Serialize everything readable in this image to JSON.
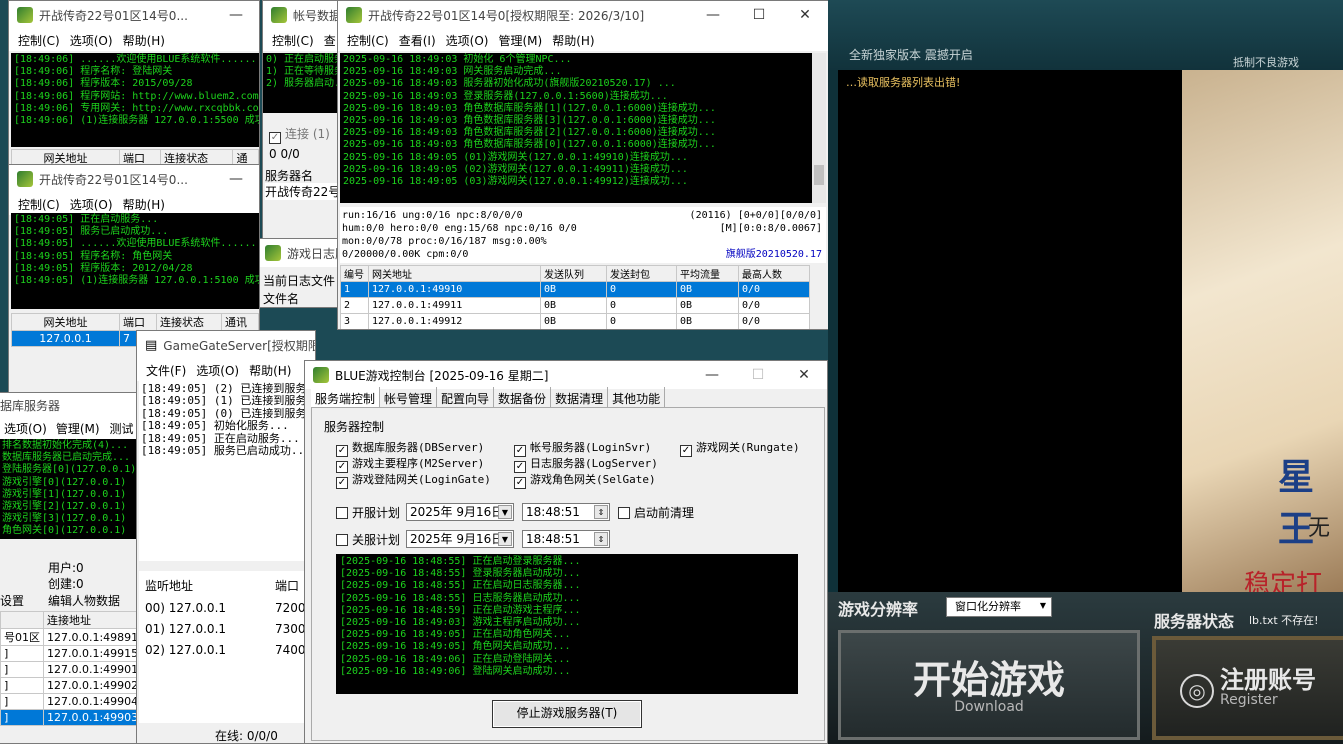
{
  "gate1": {
    "title": "开战传奇22号01区14号0...",
    "menu": [
      "控制(C)",
      "选项(O)",
      "帮助(H)"
    ],
    "log": [
      "[18:49:06] ......欢迎使用BLUE系统软件......",
      "[18:49:06] 程序名称: 登陆网关",
      "[18:49:06] 程序版本: 2015/09/28",
      "[18:49:06] 程序网站: http://www.bluem2.com",
      "[18:49:06] 专用网关: http://www.rxcqbbk.com",
      "[18:49:06] (1)连接服务器 127.0.0.1:5500 成功..."
    ],
    "cols": [
      "网关地址",
      "端口",
      "连接状态",
      "通"
    ]
  },
  "gate2": {
    "title": "开战传奇22号01区14号0...",
    "menu": [
      "控制(C)",
      "选项(O)",
      "帮助(H)"
    ],
    "log": [
      "[18:49:05] 正在启动服务...",
      "[18:49:05] 服务已启动成功...",
      "[18:49:05] ......欢迎使用BLUE系统软件......",
      "[18:49:05] 程序名称: 角色网关",
      "[18:49:05] 程序版本: 2012/04/28",
      "[18:49:05] (1)连接服务器 127.0.0.1:5100 成功"
    ],
    "cols": [
      "网关地址",
      "端口",
      "连接状态",
      "通讯"
    ],
    "rows": [
      [
        "127.0.0.1",
        "7"
      ]
    ]
  },
  "account": {
    "title": "帐号数据",
    "menu": [
      "控制(C)",
      "查"
    ],
    "log": [
      "0) 正在启动服务...",
      "1) 正在等待服务器...",
      "2) 服务器启动..."
    ],
    "check_label": "连接",
    "check_count": "(1)",
    "counts": "0   0/0",
    "header": "服务器名",
    "row": "开战传奇22号"
  },
  "logsrv": {
    "title": "游戏日志服",
    "current_file": "当前日志文件",
    "file_name": "文件名"
  },
  "m2": {
    "title": "开战传奇22号01区14号0[授权期限至: 2026/3/10]",
    "menu": [
      "控制(C)",
      "查看(I)",
      "选项(O)",
      "管理(M)",
      "帮助(H)"
    ],
    "log": [
      "2025-09-16 18:49:03 初始化 6个管理NPC...",
      "2025-09-16 18:49:03 网关服务启动完成...",
      "2025-09-16 18:49:03 服务器初始化成功(旗舰版20210520.17) ...",
      "2025-09-16 18:49:03 登录服务器(127.0.0.1:5600)连接成功...",
      "2025-09-16 18:49:03 角色数据库服务器[1](127.0.0.1:6000)连接成功...",
      "2025-09-16 18:49:03 角色数据库服务器[3](127.0.0.1:6000)连接成功...",
      "2025-09-16 18:49:03 角色数据库服务器[2](127.0.0.1:6000)连接成功...",
      "2025-09-16 18:49:03 角色数据库服务器[0](127.0.0.1:6000)连接成功...",
      "2025-09-16 18:49:05 (01)游戏网关(127.0.0.1:49910)连接成功...",
      "2025-09-16 18:49:05 (02)游戏网关(127.0.0.1:49911)连接成功...",
      "2025-09-16 18:49:05 (03)游戏网关(127.0.0.1:49912)连接成功..."
    ],
    "stat1": "run:16/16 ung:0/16 npc:8/0/0/0",
    "stat1r": "(20116) [0+0/0][0/0/0]",
    "stat2": "hum:0/0 hero:0/0 eng:15/68 npc:0/16 0/0",
    "stat2r": "[M][0:0:8/0.0067]",
    "stat3": "mon:0/0/78 proc:0/16/187 msg:0.00%",
    "stat4": "0/20000/0.00K cpm:0/0",
    "version": "旗舰版20210520.17",
    "cols": [
      "编号",
      "网关地址",
      "发送队列",
      "发送封包",
      "平均流量",
      "最高人数"
    ],
    "rows": [
      [
        "1",
        "127.0.0.1:49910",
        "0B",
        "0",
        "0B",
        "0/0"
      ],
      [
        "2",
        "127.0.0.1:49911",
        "0B",
        "0",
        "0B",
        "0/0"
      ],
      [
        "3",
        "127.0.0.1:49912",
        "0B",
        "0",
        "0B",
        "0/0"
      ]
    ]
  },
  "db": {
    "title": "据库服务器",
    "menu": [
      "选项(O)",
      "管理(M)",
      "测试"
    ],
    "log": [
      "排名数据初始化完成(4)...",
      "数据库服务器已启动完成...",
      "登陆服务器[0](127.0.0.1)",
      "游戏引擎[0](127.0.0.1)",
      "游戏引擎[1](127.0.0.1)",
      "游戏引擎[2](127.0.0.1)",
      "游戏引擎[3](127.0.0.1)",
      "角色网关[0](127.0.0.1)"
    ],
    "users": "用户:0",
    "created": "创建:0",
    "setting": "设置",
    "edit": "编辑人物数据",
    "cols": [
      "",
      "连接地址"
    ],
    "rows": [
      [
        "号01区",
        "127.0.0.1:49891"
      ],
      [
        "]",
        "127.0.0.1:49915"
      ],
      [
        "]",
        "127.0.0.1:49901"
      ],
      [
        "]",
        "127.0.0.1:49902"
      ],
      [
        "]",
        "127.0.0.1:49904"
      ],
      [
        "]",
        "127.0.0.1:49903"
      ]
    ]
  },
  "gamegate": {
    "title": "GameGateServer[授权期限至:",
    "menu": [
      "文件(F)",
      "选项(O)",
      "帮助(H)"
    ],
    "log": [
      "[18:49:05] (2) 已连接到服务器",
      "[18:49:05] (1) 已连接到服务器",
      "[18:49:05] (0) 已连接到服务器",
      "[18:49:05] 初始化服务...",
      "[18:49:05] 正在启动服务...",
      "[18:49:05] 服务已启动成功..."
    ],
    "cols": [
      "监听地址",
      "端口"
    ],
    "rows": [
      [
        "00) 127.0.0.1",
        "7200"
      ],
      [
        "01) 127.0.0.1",
        "7300"
      ],
      [
        "02) 127.0.0.1",
        "7400"
      ]
    ],
    "online": "在线: 0/0/0"
  },
  "console": {
    "title": "BLUE游戏控制台 [2025-09-16 星期二]",
    "tabs": [
      "服务端控制",
      "帐号管理",
      "配置向导",
      "数据备份",
      "数据清理",
      "其他功能"
    ],
    "group": "服务器控制",
    "checks": [
      {
        "label": "数据库服务器(DBServer)",
        "checked": true
      },
      {
        "label": "帐号服务器(LoginSvr)",
        "checked": true
      },
      {
        "label": "游戏网关(Rungate)",
        "checked": true
      },
      {
        "label": "游戏主要程序(M2Server)",
        "checked": true
      },
      {
        "label": "日志服务器(LogServer)",
        "checked": true
      },
      {
        "label": "游戏登陆网关(LoginGate)",
        "checked": true
      },
      {
        "label": "游戏角色网关(SelGate)",
        "checked": true
      }
    ],
    "open_plan": "开服计划",
    "close_plan": "关服计划",
    "date": "2025年 9月16日",
    "time": "18:48:51",
    "clean": "启动前清理",
    "log": [
      "[2025-09-16 18:48:55] 正在启动登录服务器...",
      "[2025-09-16 18:48:55] 登录服务器启动成功...",
      "[2025-09-16 18:48:55] 正在启动日志服务器...",
      "[2025-09-16 18:48:55] 日志服务器启动成功...",
      "[2025-09-16 18:48:59] 正在启动游戏主程序...",
      "[2025-09-16 18:49:03] 游戏主程序启动成功...",
      "[2025-09-16 18:49:05] 正在启动角色网关...",
      "[2025-09-16 18:49:05] 角色网关启动成功...",
      "[2025-09-16 18:49:06] 正在启动登陆网关...",
      "[2025-09-16 18:49:06] 登陆网关启动成功..."
    ],
    "stop": "停止游戏服务器(T)"
  },
  "launcher": {
    "header": "全新独家版本 震撼开启",
    "header_right": "抵制不良游戏",
    "error": "读取服务器列表出错!",
    "res_label": "游戏分辨率",
    "res_value": "窗口化分辨率",
    "status_label": "服务器状态",
    "status_value": "lb.txt 不存在!",
    "start": "开始游戏",
    "start_sub": "Download",
    "register": "注册账号",
    "register_sub": "Register",
    "banner1": "星王",
    "banner2": "无",
    "banner3": "稳定打"
  }
}
